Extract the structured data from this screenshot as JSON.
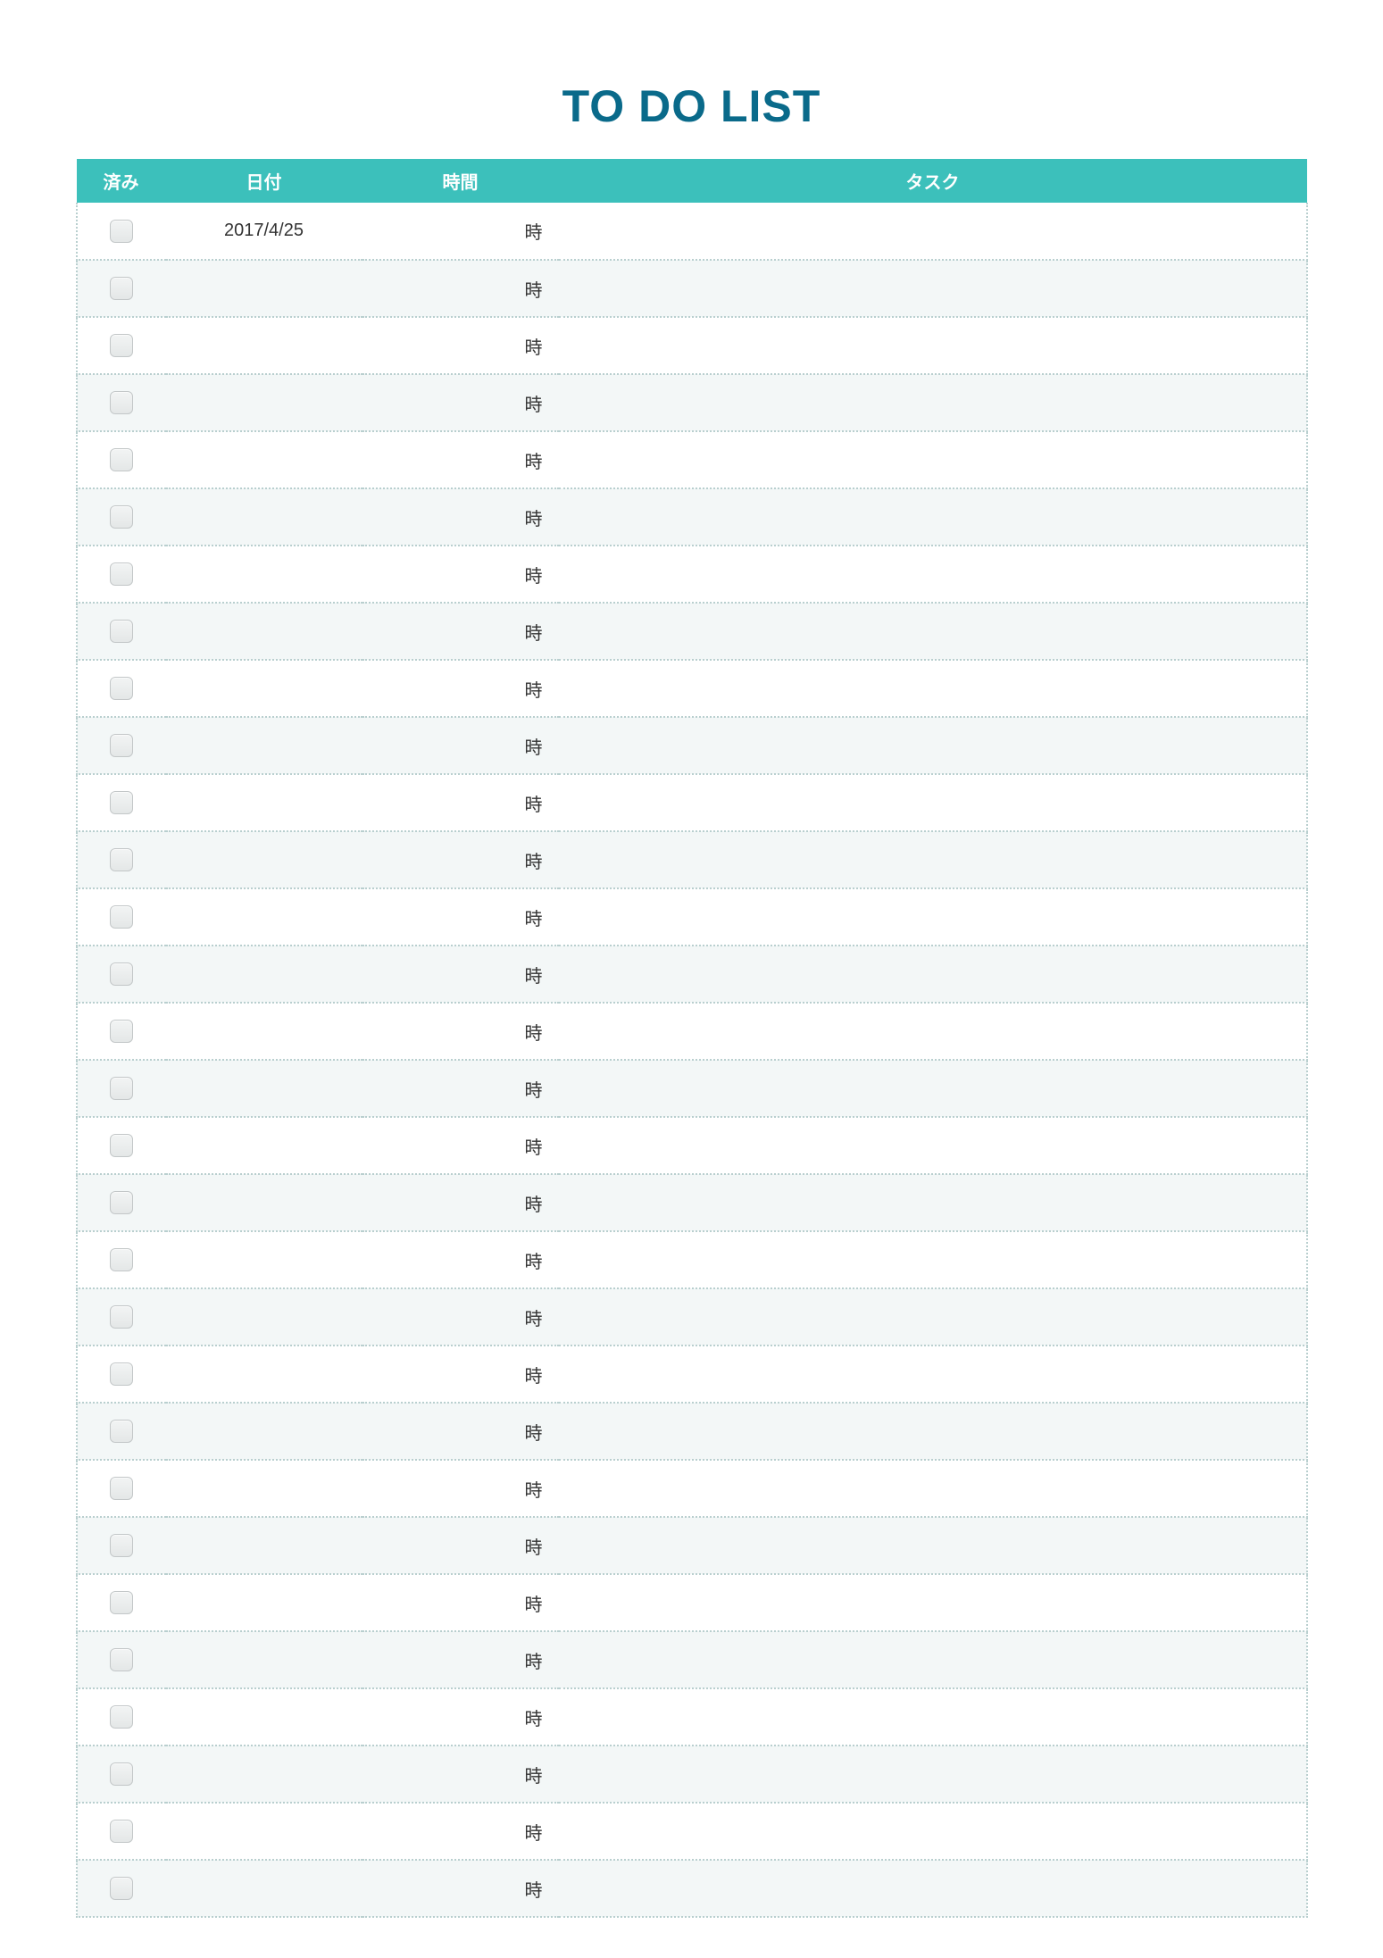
{
  "title": "TO DO LIST",
  "columns": {
    "done": "済み",
    "date": "日付",
    "time": "時間",
    "task": "タスク"
  },
  "time_suffix": "時",
  "rows": [
    {
      "done": false,
      "date": "2017/4/25",
      "time": "",
      "task": ""
    },
    {
      "done": false,
      "date": "",
      "time": "",
      "task": ""
    },
    {
      "done": false,
      "date": "",
      "time": "",
      "task": ""
    },
    {
      "done": false,
      "date": "",
      "time": "",
      "task": ""
    },
    {
      "done": false,
      "date": "",
      "time": "",
      "task": ""
    },
    {
      "done": false,
      "date": "",
      "time": "",
      "task": ""
    },
    {
      "done": false,
      "date": "",
      "time": "",
      "task": ""
    },
    {
      "done": false,
      "date": "",
      "time": "",
      "task": ""
    },
    {
      "done": false,
      "date": "",
      "time": "",
      "task": ""
    },
    {
      "done": false,
      "date": "",
      "time": "",
      "task": ""
    },
    {
      "done": false,
      "date": "",
      "time": "",
      "task": ""
    },
    {
      "done": false,
      "date": "",
      "time": "",
      "task": ""
    },
    {
      "done": false,
      "date": "",
      "time": "",
      "task": ""
    },
    {
      "done": false,
      "date": "",
      "time": "",
      "task": ""
    },
    {
      "done": false,
      "date": "",
      "time": "",
      "task": ""
    },
    {
      "done": false,
      "date": "",
      "time": "",
      "task": ""
    },
    {
      "done": false,
      "date": "",
      "time": "",
      "task": ""
    },
    {
      "done": false,
      "date": "",
      "time": "",
      "task": ""
    },
    {
      "done": false,
      "date": "",
      "time": "",
      "task": ""
    },
    {
      "done": false,
      "date": "",
      "time": "",
      "task": ""
    },
    {
      "done": false,
      "date": "",
      "time": "",
      "task": ""
    },
    {
      "done": false,
      "date": "",
      "time": "",
      "task": ""
    },
    {
      "done": false,
      "date": "",
      "time": "",
      "task": ""
    },
    {
      "done": false,
      "date": "",
      "time": "",
      "task": ""
    },
    {
      "done": false,
      "date": "",
      "time": "",
      "task": ""
    },
    {
      "done": false,
      "date": "",
      "time": "",
      "task": ""
    },
    {
      "done": false,
      "date": "",
      "time": "",
      "task": ""
    },
    {
      "done": false,
      "date": "",
      "time": "",
      "task": ""
    },
    {
      "done": false,
      "date": "",
      "time": "",
      "task": ""
    },
    {
      "done": false,
      "date": "",
      "time": "",
      "task": ""
    }
  ]
}
